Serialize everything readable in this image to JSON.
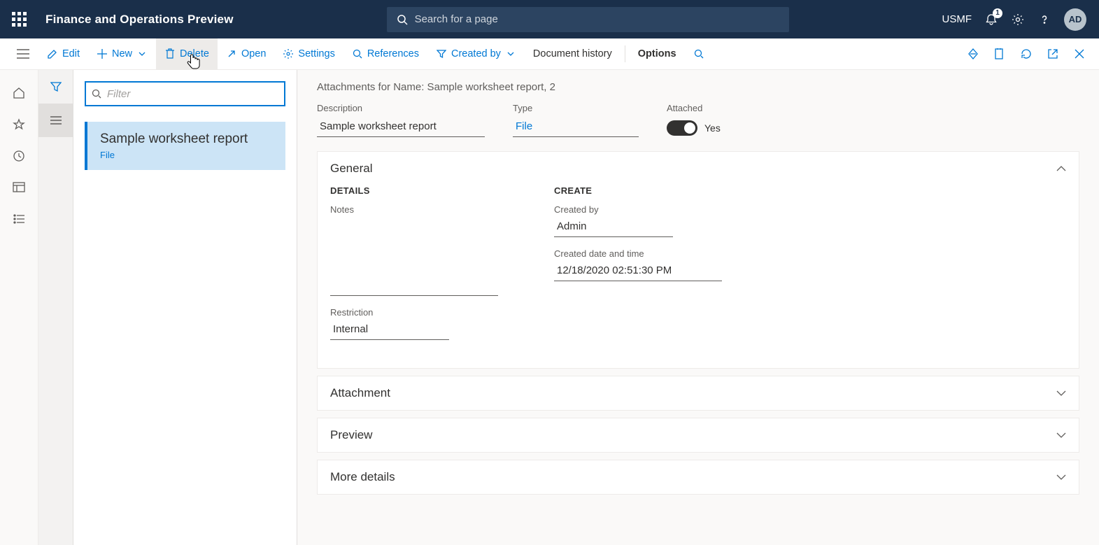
{
  "header": {
    "appTitle": "Finance and Operations Preview",
    "searchPlaceholder": "Search for a page",
    "company": "USMF",
    "notificationCount": "1",
    "avatar": "AD"
  },
  "actions": {
    "edit": "Edit",
    "new": "New",
    "delete": "Delete",
    "open": "Open",
    "settings": "Settings",
    "references": "References",
    "createdBy": "Created by",
    "documentHistory": "Document history",
    "options": "Options"
  },
  "list": {
    "filterPlaceholder": "Filter",
    "card": {
      "title": "Sample worksheet report",
      "sub": "File"
    }
  },
  "content": {
    "breadcrumb": "Attachments for Name: Sample worksheet report, 2",
    "descriptionLabel": "Description",
    "descriptionValue": "Sample worksheet report",
    "typeLabel": "Type",
    "typeValue": "File",
    "attachedLabel": "Attached",
    "attachedValue": "Yes",
    "sections": {
      "general": "General",
      "attachment": "Attachment",
      "preview": "Preview",
      "moreDetails": "More details"
    },
    "detailsHead": "DETAILS",
    "createHead": "CREATE",
    "notesLabel": "Notes",
    "restrictionLabel": "Restriction",
    "restrictionValue": "Internal",
    "createdByLabel": "Created by",
    "createdByValue": "Admin",
    "createdDateLabel": "Created date and time",
    "createdDateValue": "12/18/2020 02:51:30 PM"
  }
}
